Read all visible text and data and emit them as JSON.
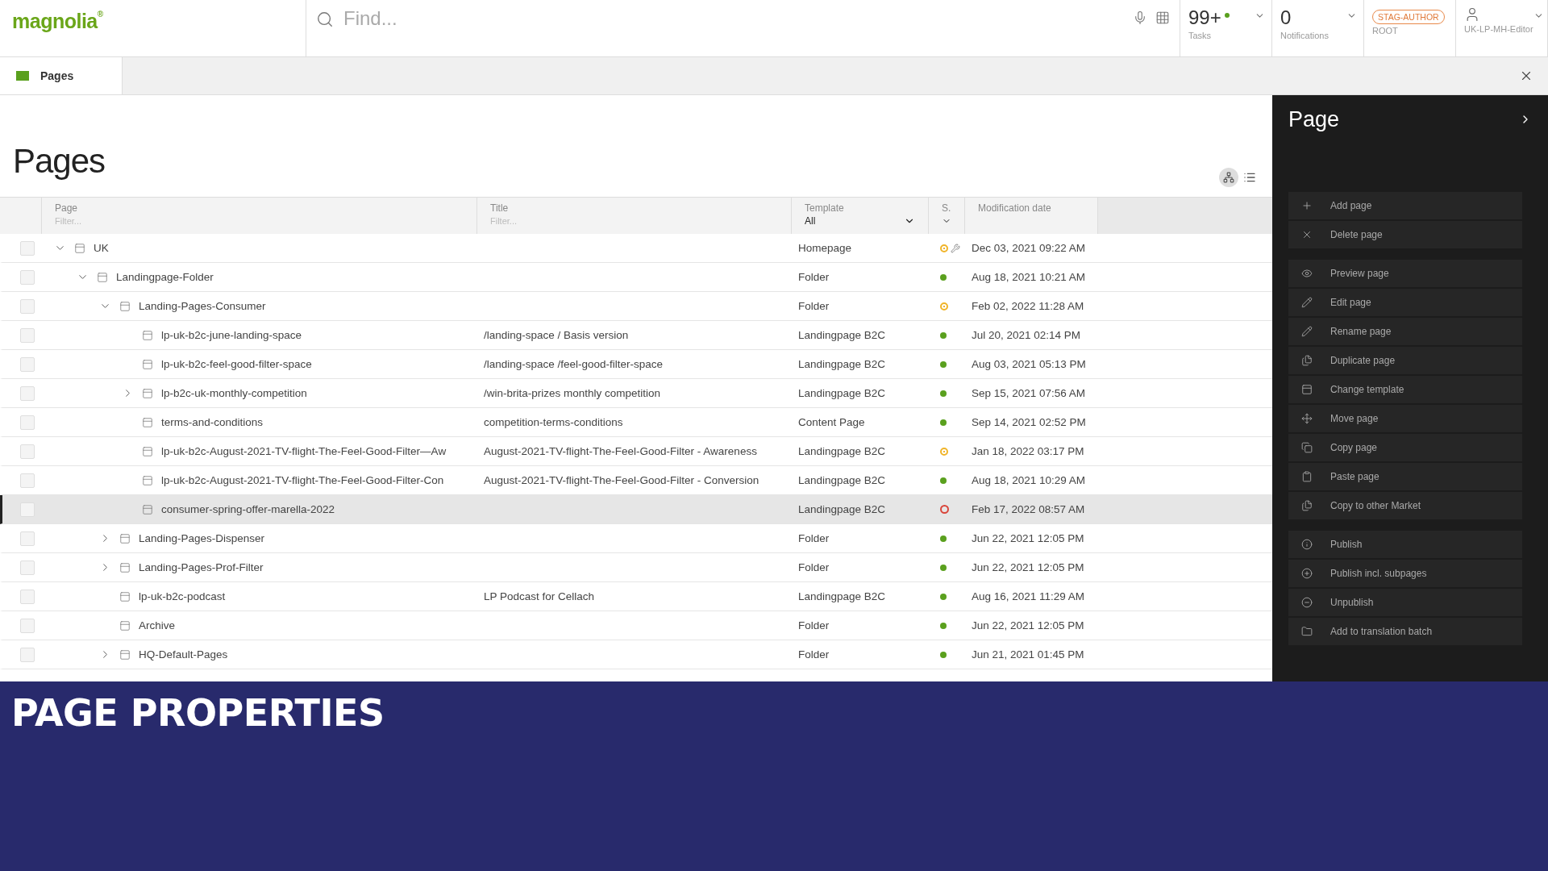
{
  "header": {
    "logo": "magnolia",
    "logo_mark": "®",
    "search": {
      "placeholder": "Find..."
    },
    "tasks": {
      "count": "99+",
      "label": "Tasks"
    },
    "notifications": {
      "count": "0",
      "label": "Notifications"
    },
    "instance": {
      "badge": "STAG-AUTHOR",
      "label": "ROOT"
    },
    "user": {
      "name": "UK-LP-MH-Editor"
    }
  },
  "tabs": [
    {
      "label": "Pages",
      "selected": true
    }
  ],
  "main": {
    "title": "Pages"
  },
  "table": {
    "columns": [
      {
        "kind": "filter",
        "label": "Page",
        "placeholder": "Filter..."
      },
      {
        "kind": "filter",
        "label": "Title",
        "placeholder": "Filter..."
      },
      {
        "kind": "select",
        "label": "Template",
        "value": "All"
      },
      {
        "kind": "select",
        "label": "S."
      },
      {
        "kind": "plain",
        "label": "Modification date"
      }
    ],
    "rows": [
      {
        "page": "UK",
        "template": "Homepage",
        "status": {
          "kind": "ring-dot",
          "color": "#f0b429"
        },
        "tools": true,
        "date": "Dec 03, 2021 09:22 AM",
        "selected": false,
        "expanded": true,
        "children": [
          {
            "page": "Landingpage-Folder",
            "template": "Folder",
            "status": {
              "kind": "filled",
              "color": "#5aa01e"
            },
            "date": "Aug 18, 2021 10:21 AM",
            "selected": false,
            "expanded": true,
            "children": [
              {
                "page": "Landing-Pages-Consumer",
                "template": "Folder",
                "status": {
                  "kind": "ring-dot",
                  "color": "#f0b429"
                },
                "date": "Feb 02, 2022 11:28 AM",
                "selected": false,
                "expanded": true,
                "children": [
                  {
                    "page": "lp-uk-b2c-june-landing-space",
                    "title": "/landing-space / Basis version",
                    "template": "Landingpage B2C",
                    "status": {
                      "kind": "filled",
                      "color": "#5aa01e"
                    },
                    "date": "Jul 20, 2021 02:14 PM",
                    "selected": false
                  },
                  {
                    "page": "lp-uk-b2c-feel-good-filter-space",
                    "title": "/landing-space /feel-good-filter-space",
                    "template": "Landingpage B2C",
                    "status": {
                      "kind": "filled",
                      "color": "#5aa01e"
                    },
                    "date": "Aug 03, 2021 05:13 PM",
                    "selected": false
                  },
                  {
                    "page": "lp-b2c-uk-monthly-competition",
                    "title": "/win-brita-prizes monthly competition",
                    "template": "Landingpage B2C",
                    "status": {
                      "kind": "filled",
                      "color": "#5aa01e"
                    },
                    "date": "Sep 15, 2021 07:56 AM",
                    "selected": false,
                    "expanded": false
                  },
                  {
                    "page": "terms-and-conditions",
                    "title": "competition-terms-conditions",
                    "template": "Content Page",
                    "status": {
                      "kind": "filled",
                      "color": "#5aa01e"
                    },
                    "date": "Sep 14, 2021 02:52 PM",
                    "selected": false
                  },
                  {
                    "page": "lp-uk-b2c-August-2021-TV-flight-The-Feel-Good-Filter—Aw",
                    "title": "August-2021-TV-flight-The-Feel-Good-Filter - Awareness",
                    "template": "Landingpage B2C",
                    "status": {
                      "kind": "ring-dot",
                      "color": "#f0b429"
                    },
                    "date": "Jan 18, 2022 03:17 PM",
                    "selected": false
                  },
                  {
                    "page": "lp-uk-b2c-August-2021-TV-flight-The-Feel-Good-Filter-Con",
                    "title": "August-2021-TV-flight-The-Feel-Good-Filter - Conversion",
                    "template": "Landingpage B2C",
                    "status": {
                      "kind": "filled",
                      "color": "#5aa01e"
                    },
                    "date": "Aug 18, 2021 10:29 AM",
                    "selected": false
                  },
                  {
                    "page": "consumer-spring-offer-marella-2022",
                    "template": "Landingpage B2C",
                    "status": {
                      "kind": "ring",
                      "color": "#d9453a"
                    },
                    "date": "Feb 17, 2022 08:57 AM",
                    "selected": true
                  }
                ]
              },
              {
                "page": "Landing-Pages-Dispenser",
                "template": "Folder",
                "status": {
                  "kind": "filled",
                  "color": "#5aa01e"
                },
                "date": "Jun 22, 2021 12:05 PM",
                "selected": false,
                "expanded": false
              },
              {
                "page": "Landing-Pages-Prof-Filter",
                "template": "Folder",
                "status": {
                  "kind": "filled",
                  "color": "#5aa01e"
                },
                "date": "Jun 22, 2021 12:05 PM",
                "selected": false,
                "expanded": false
              },
              {
                "page": "lp-uk-b2c-podcast",
                "title": "LP Podcast for Cellach",
                "template": "Landingpage B2C",
                "status": {
                  "kind": "filled",
                  "color": "#5aa01e"
                },
                "date": "Aug 16, 2021 11:29 AM",
                "selected": false
              },
              {
                "page": "Archive",
                "template": "Folder",
                "status": {
                  "kind": "filled",
                  "color": "#5aa01e"
                },
                "date": "Jun 22, 2021 12:05 PM",
                "selected": false
              },
              {
                "page": "HQ-Default-Pages",
                "template": "Folder",
                "status": {
                  "kind": "filled",
                  "color": "#5aa01e"
                },
                "date": "Jun 21, 2021 01:45 PM",
                "selected": false,
                "expanded": false
              }
            ]
          }
        ]
      }
    ]
  },
  "actions": {
    "title": "Page",
    "groups": [
      [
        "Add page",
        "Delete page"
      ],
      [
        "Preview page",
        "Edit page",
        "Rename page",
        "Duplicate page",
        "Change template",
        "Move page",
        "Copy page",
        "Paste page",
        "Copy to other Market"
      ],
      [
        "Publish",
        "Publish incl. subpages",
        "Unpublish",
        "Add to translation batch"
      ]
    ]
  },
  "banner": {
    "title": "PAGE PROPERTIES"
  }
}
